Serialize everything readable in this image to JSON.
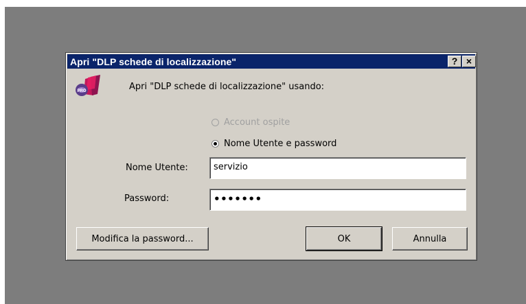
{
  "dialog": {
    "title": "Apri \"DLP schede di localizzazione\"",
    "help_button": "?",
    "close_button": "×",
    "prompt": "Apri \"DLP schede di localizzazione\" usando:"
  },
  "options": {
    "guest_label": "Account ospite",
    "guest_enabled": false,
    "user_label": "Nome Utente e password",
    "selected": "user"
  },
  "fields": {
    "username_label": "Nome Utente:",
    "username_value": "servizio",
    "password_label": "Password:",
    "password_mask": "•••••••"
  },
  "buttons": {
    "change_password": "Modifica la password...",
    "ok": "OK",
    "cancel": "Annulla"
  },
  "colors": {
    "titlebar": "#0a246a",
    "dialog_face": "#d4d0c8",
    "desktop": "#7d7d7d"
  },
  "icons": {
    "app": "filemaker-pro-icon"
  }
}
